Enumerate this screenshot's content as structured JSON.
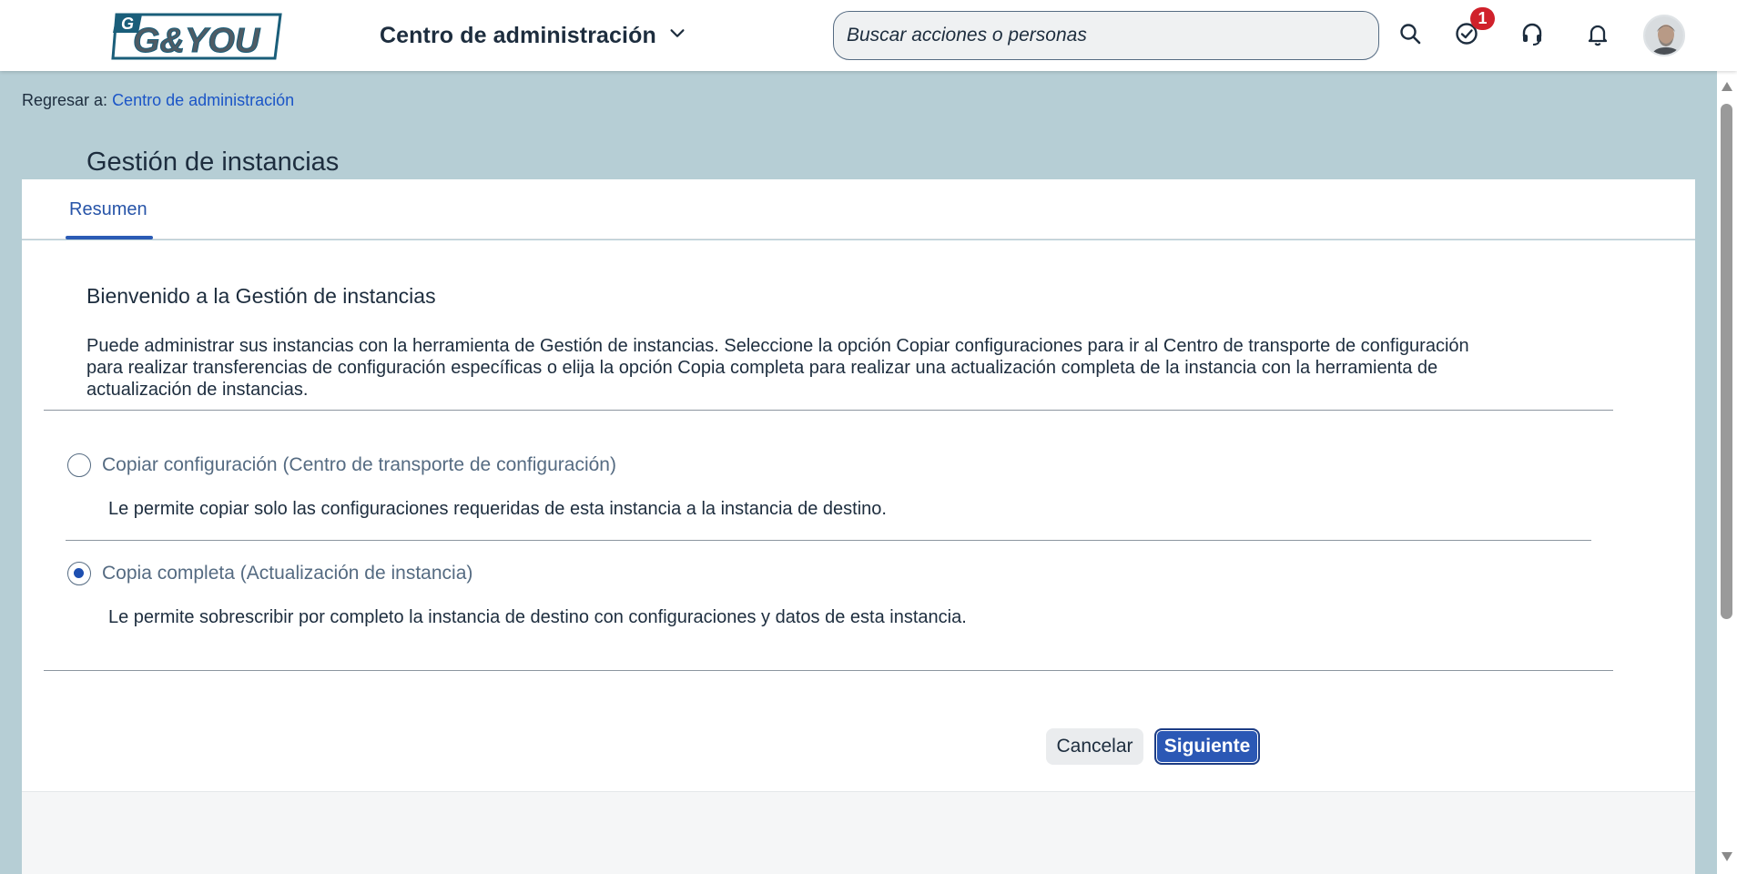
{
  "shell": {
    "logo_text": "G&YOU",
    "logo_small": "G",
    "product_title": "Centro de administración",
    "search_placeholder": "Buscar acciones o personas",
    "todo_badge": "1",
    "icons": [
      "search-icon",
      "todo-check-icon",
      "headset-icon",
      "bell-icon",
      "avatar"
    ]
  },
  "breadcrumb": {
    "prefix": "Regresar a:",
    "link": "Centro de administración"
  },
  "page": {
    "title": "Gestión de instancias",
    "tabs": [
      {
        "label": "Resumen",
        "selected": true
      }
    ]
  },
  "welcome": {
    "title": "Bienvenido a la Gestión de instancias",
    "line1": "Puede administrar sus instancias con la herramienta de Gestión de instancias. Seleccione la opción Copiar configuraciones para ir al Centro de transporte de configuración",
    "line2": "para realizar transferencias de configuración específicas o elija la opción Copia completa para realizar una actualización completa de la instancia con la herramienta de",
    "line3": "actualización de instancias."
  },
  "options": [
    {
      "label": "Copiar configuración (Centro de transporte de configuración)",
      "description": "Le permite copiar solo las configuraciones requeridas de esta instancia a la instancia de destino.",
      "selected": false
    },
    {
      "label": "Copia completa (Actualización de instancia)",
      "description": "Le permite sobrescribir por completo la instancia de destino con configuraciones y datos de esta instancia.",
      "selected": true
    }
  ],
  "actions": {
    "cancel": "Cancelar",
    "next": "Siguiente"
  },
  "colors": {
    "accent": "#2b58b5",
    "page_background": "#b6ced5",
    "badge": "#d0212b",
    "link": "#1b55c7"
  }
}
